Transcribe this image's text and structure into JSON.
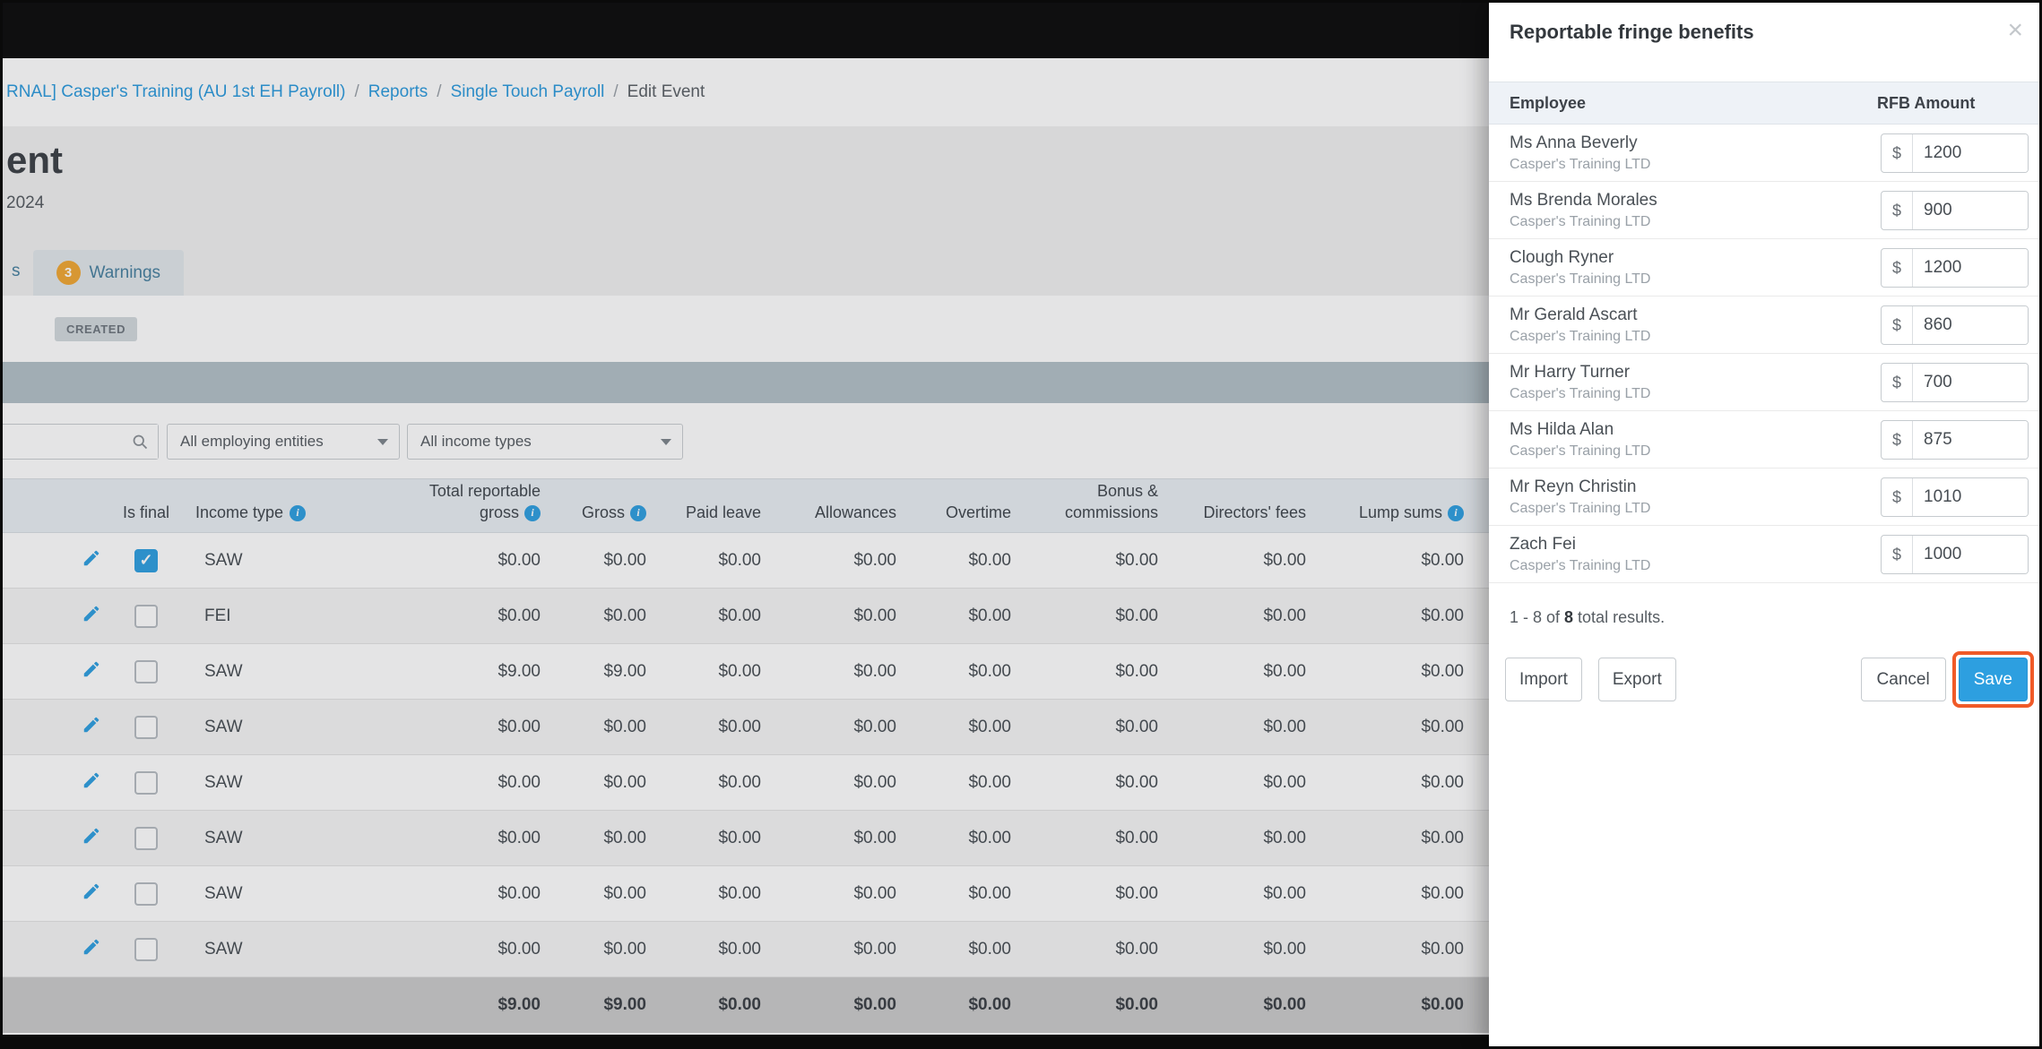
{
  "page": {
    "breadcrumb": {
      "separator": "/",
      "items": [
        "RNAL] Casper's Training (AU 1st EH Payroll)",
        "Reports",
        "Single Touch Payroll",
        "Edit Event"
      ]
    },
    "header": {
      "title_fragment": "ent",
      "date_fragment": "2024",
      "tab_fragment": "s",
      "warnings_tab": {
        "badge": "3",
        "label": "Warnings"
      },
      "status_badge": "CREATED"
    },
    "filters": {
      "entities_dropdown": "All employing entities",
      "income_types_dropdown": "All income types"
    },
    "table": {
      "headers": {
        "is_final": "Is final",
        "income_type": "Income type",
        "total_reportable_gross_lines": [
          "Total reportable",
          "gross"
        ],
        "gross": "Gross",
        "paid_leave": "Paid leave",
        "allowances": "Allowances",
        "overtime": "Overtime",
        "bonus_commissions_lines": [
          "Bonus &",
          "commissions"
        ],
        "directors_fees": "Directors' fees",
        "lump_sums": "Lump sums"
      },
      "rows": [
        {
          "is_final": true,
          "income_type": "SAW",
          "values": [
            "$0.00",
            "$0.00",
            "$0.00",
            "$0.00",
            "$0.00",
            "$0.00",
            "$0.00",
            "$0.00"
          ]
        },
        {
          "is_final": false,
          "income_type": "FEI",
          "values": [
            "$0.00",
            "$0.00",
            "$0.00",
            "$0.00",
            "$0.00",
            "$0.00",
            "$0.00",
            "$0.00"
          ]
        },
        {
          "is_final": false,
          "income_type": "SAW",
          "values": [
            "$9.00",
            "$9.00",
            "$0.00",
            "$0.00",
            "$0.00",
            "$0.00",
            "$0.00",
            "$0.00"
          ]
        },
        {
          "is_final": false,
          "income_type": "SAW",
          "values": [
            "$0.00",
            "$0.00",
            "$0.00",
            "$0.00",
            "$0.00",
            "$0.00",
            "$0.00",
            "$0.00"
          ]
        },
        {
          "is_final": false,
          "income_type": "SAW",
          "values": [
            "$0.00",
            "$0.00",
            "$0.00",
            "$0.00",
            "$0.00",
            "$0.00",
            "$0.00",
            "$0.00"
          ]
        },
        {
          "is_final": false,
          "income_type": "SAW",
          "values": [
            "$0.00",
            "$0.00",
            "$0.00",
            "$0.00",
            "$0.00",
            "$0.00",
            "$0.00",
            "$0.00"
          ]
        },
        {
          "is_final": false,
          "income_type": "SAW",
          "values": [
            "$0.00",
            "$0.00",
            "$0.00",
            "$0.00",
            "$0.00",
            "$0.00",
            "$0.00",
            "$0.00"
          ]
        },
        {
          "is_final": false,
          "income_type": "SAW",
          "values": [
            "$0.00",
            "$0.00",
            "$0.00",
            "$0.00",
            "$0.00",
            "$0.00",
            "$0.00",
            "$0.00"
          ]
        }
      ],
      "totals": [
        "$9.00",
        "$9.00",
        "$0.00",
        "$0.00",
        "$0.00",
        "$0.00",
        "$0.00",
        "$0.00"
      ]
    }
  },
  "modal": {
    "title": "Reportable fringe benefits",
    "columns": {
      "employee": "Employee",
      "rfb_amount": "RFB Amount"
    },
    "currency_symbol": "$",
    "rows": [
      {
        "name": "Ms Anna Beverly",
        "company": "Casper's Training LTD",
        "amount": "1200"
      },
      {
        "name": "Ms Brenda Morales",
        "company": "Casper's Training LTD",
        "amount": "900"
      },
      {
        "name": "Clough Ryner",
        "company": "Casper's Training LTD",
        "amount": "1200"
      },
      {
        "name": "Mr Gerald Ascart",
        "company": "Casper's Training LTD",
        "amount": "860"
      },
      {
        "name": "Mr Harry Turner",
        "company": "Casper's Training LTD",
        "amount": "700"
      },
      {
        "name": "Ms Hilda Alan",
        "company": "Casper's Training LTD",
        "amount": "875"
      },
      {
        "name": "Mr Reyn Christin",
        "company": "Casper's Training LTD",
        "amount": "1010"
      },
      {
        "name": "Zach Fei",
        "company": "Casper's Training LTD",
        "amount": "1000"
      }
    ],
    "results_text": {
      "prefix": "1 - 8 of ",
      "total": "8",
      "suffix": " total results."
    },
    "buttons": {
      "import": "Import",
      "export": "Export",
      "cancel": "Cancel",
      "save": "Save"
    }
  },
  "colors": {
    "accent_blue": "#2d9fe0",
    "warning_orange": "#f0a733",
    "highlight_ring": "#f05a28"
  }
}
